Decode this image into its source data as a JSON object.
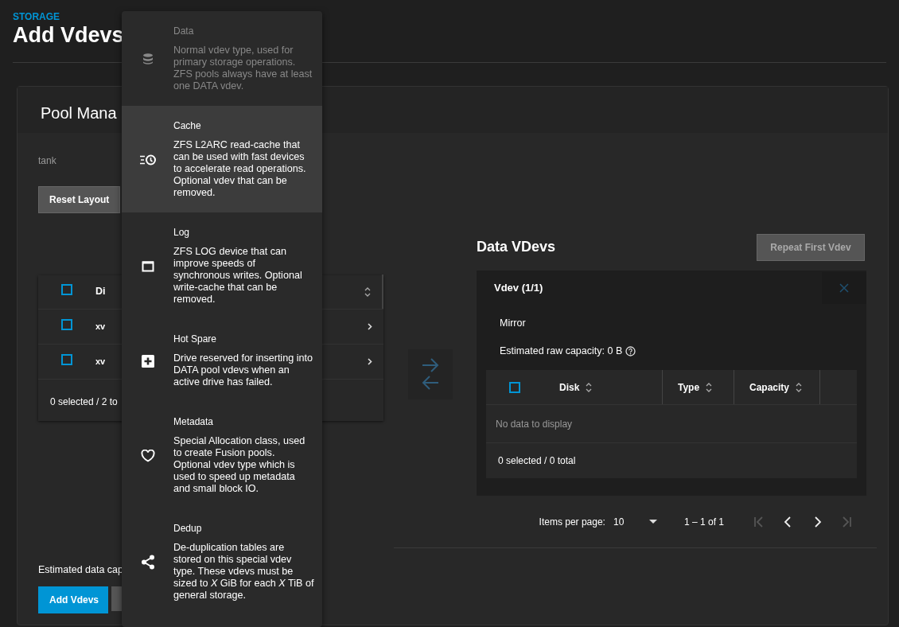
{
  "page": {
    "breadcrumb": "STORAGE",
    "title": "Add Vdevs"
  },
  "pool_manager": {
    "title": "Pool Mana",
    "pool_name": "tank",
    "reset_button": "Reset Layout",
    "disks_table": {
      "header_checked": false,
      "columns": [
        "Di"
      ],
      "rows": [
        {
          "disk": "xv",
          "checked": false
        },
        {
          "disk": "xv",
          "checked": false
        }
      ],
      "footer": "0 selected / 2 to"
    },
    "estimate": "Estimated data cap",
    "add_button": "Add Vdevs"
  },
  "data_vdevs": {
    "title": "Data VDevs",
    "repeat_button": {
      "label": "Repeat First Vdev",
      "disabled": true
    },
    "vdevs": [
      {
        "title": "Vdev (1/1)",
        "layout": "Mirror",
        "capacity": "Estimated raw capacity: 0 B",
        "table": {
          "header_checked": false,
          "columns": [
            "Disk",
            "Type",
            "Capacity"
          ],
          "empty": "No data to display",
          "footer": "0 selected / 0 total"
        }
      }
    ],
    "pagination": {
      "label": "Items per page:",
      "size": "10",
      "range": "1 – 1 of 1"
    }
  },
  "vdev_type_menu": {
    "items": [
      {
        "kind": "data",
        "title": "Data",
        "description": "Normal vdev type, used for primary storage operations. ZFS pools always have at least one DATA vdev.",
        "selected": false,
        "disabled": true
      },
      {
        "kind": "cache",
        "title": "Cache",
        "description": "ZFS L2ARC read-cache that can be used with fast devices to accelerate read operations. Optional vdev that can be removed.",
        "selected": true,
        "disabled": false
      },
      {
        "kind": "log",
        "title": "Log",
        "description": "ZFS LOG device that can improve speeds of synchronous writes. Optional write-cache that can be removed.",
        "selected": false,
        "disabled": false
      },
      {
        "kind": "spare",
        "title": "Hot Spare",
        "description": "Drive reserved for inserting into DATA pool vdevs when an active drive has failed.",
        "selected": false,
        "disabled": false
      },
      {
        "kind": "metadata",
        "title": "Metadata",
        "description": "Special Allocation class, used to create Fusion pools. Optional vdev type which is used to speed up metadata and small block IO.",
        "selected": false,
        "disabled": false
      },
      {
        "kind": "dedup",
        "title": "Dedup",
        "description": "De-duplication tables are stored on this special vdev type. These vdevs must be sized to *X* GiB for each *X* TiB of general storage.",
        "selected": false,
        "disabled": false
      }
    ]
  }
}
